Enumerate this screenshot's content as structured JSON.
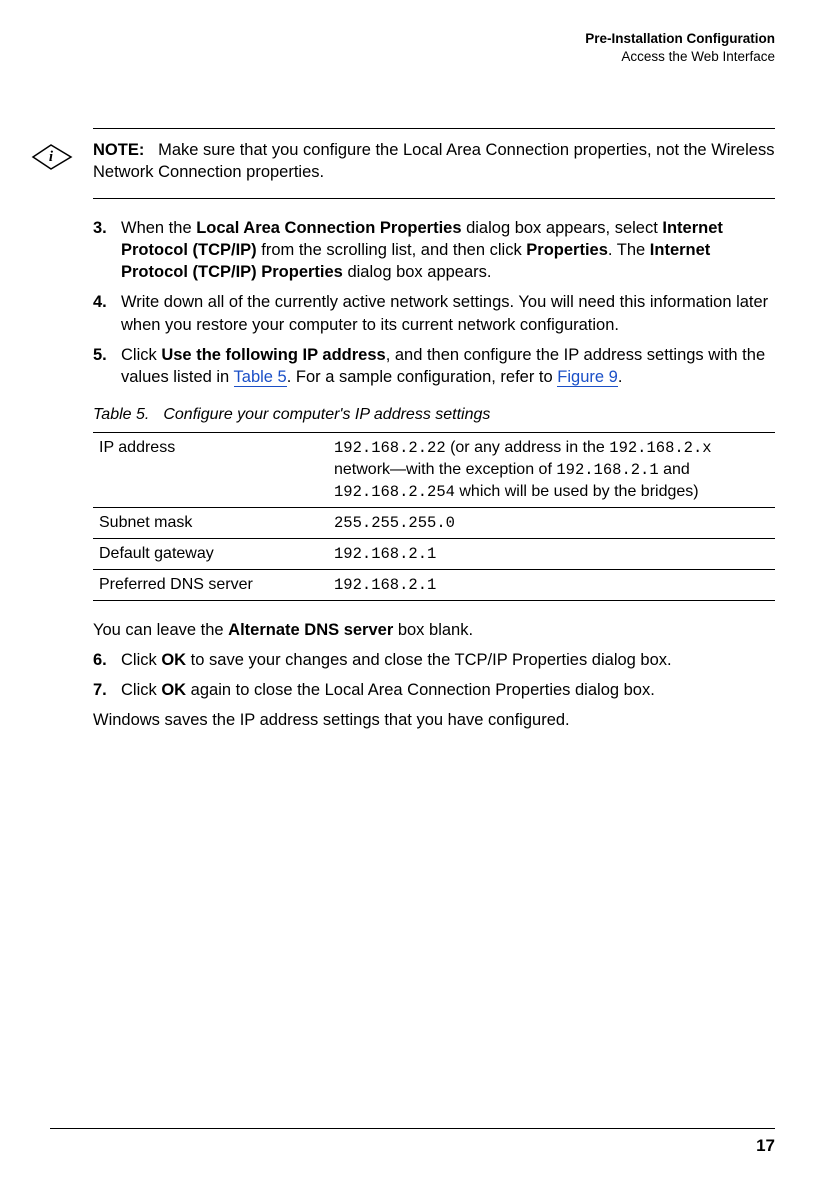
{
  "header": {
    "line1": "Pre-Installation Configuration",
    "line2": "Access the Web Interface"
  },
  "note": {
    "label": "NOTE:",
    "text": "Make sure that you configure the Local Area Connection properties, not the Wireless Network Connection properties."
  },
  "steps": {
    "s3": {
      "num": "3.",
      "pre": "When the ",
      "b1": "Local Area Connection Properties",
      "mid1": " dialog box appears, select ",
      "b2": "Internet Protocol (TCP/IP)",
      "mid2": " from the scrolling list, and then click ",
      "b3": "Properties",
      "mid3": ". The ",
      "b4": "Internet Protocol (TCP/IP) Properties",
      "post": " dialog box appears."
    },
    "s4": {
      "num": "4.",
      "text": "Write down all of the currently active network settings. You will need this information later when you restore your computer to its current network configuration."
    },
    "s5": {
      "num": "5.",
      "pre": "Click ",
      "b1": "Use the following IP address",
      "mid1": ", and then configure the IP address settings with the values listed in ",
      "xref1": "Table 5",
      "mid2": ". For a sample configuration, refer to ",
      "xref2": "Figure 9",
      "post": "."
    },
    "s6": {
      "num": "6.",
      "pre": "Click ",
      "b1": "OK",
      "post": " to save your changes and close the TCP/IP Properties dialog box."
    },
    "s7": {
      "num": "7.",
      "pre": "Click ",
      "b1": "OK",
      "post": " again to close the Local Area Connection Properties dialog box."
    }
  },
  "table": {
    "label": "Table 5.",
    "caption": "Configure your computer's IP address settings",
    "rows": [
      {
        "k": "IP address",
        "mono1": "192.168.2.22",
        "txt1": " (or any address in the ",
        "mono2": "192.168.2.x",
        "txt2": " network—with the exception of ",
        "mono3": "192.168.2.1",
        "txt3": "  and ",
        "mono4": "192.168.2.254",
        "txt4": " which will be used by the bridges)"
      },
      {
        "k": "Subnet mask",
        "mono1": "255.255.255.0"
      },
      {
        "k": "Default gateway",
        "mono1": "192.168.2.1"
      },
      {
        "k": "Preferred DNS server",
        "mono1": "192.168.2.1"
      }
    ]
  },
  "paras": {
    "alt_dns_pre": "You can leave the ",
    "alt_dns_b": "Alternate DNS server",
    "alt_dns_post": " box blank.",
    "win_save": "Windows saves the IP address settings that you have configured."
  },
  "footer": {
    "page": "17"
  }
}
